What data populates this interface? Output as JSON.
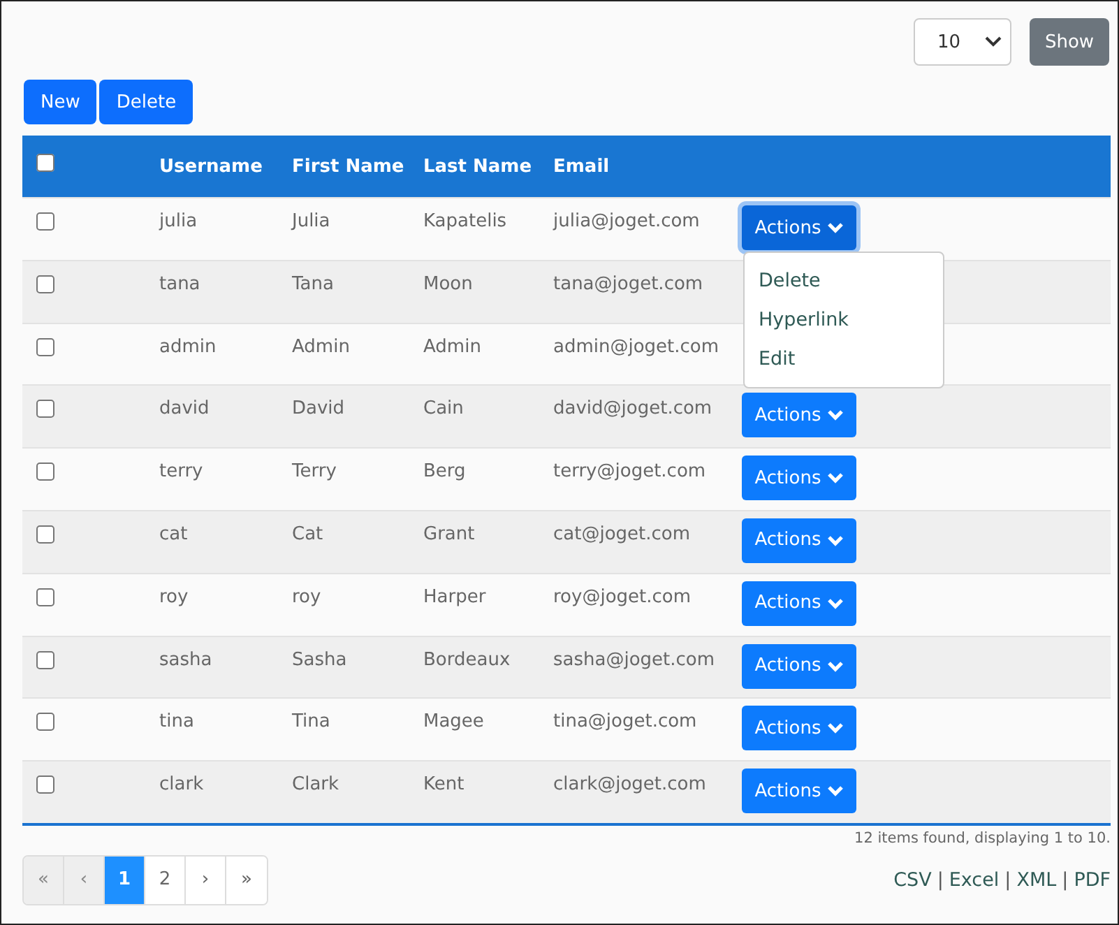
{
  "page_size": {
    "value": "10"
  },
  "show_button": "Show",
  "buttons": [
    "New",
    "Delete"
  ],
  "table": {
    "select_all": {
      "checked": false
    },
    "columns": [
      "Username",
      "First Name",
      "Last Name",
      "Email"
    ],
    "rows": [
      {
        "checked": false,
        "cells": [
          "julia",
          "Julia",
          "Kapatelis",
          "julia@joget.com"
        ],
        "actions": "Actions",
        "focused": true
      },
      {
        "checked": false,
        "cells": [
          "tana",
          "Tana",
          "Moon",
          "tana@joget.com"
        ]
      },
      {
        "checked": false,
        "cells": [
          "admin",
          "Admin",
          "Admin",
          "admin@joget.com"
        ]
      },
      {
        "checked": false,
        "cells": [
          "david",
          "David",
          "Cain",
          "david@joget.com"
        ],
        "actions": "Actions",
        "focused": false
      },
      {
        "checked": false,
        "cells": [
          "terry",
          "Terry",
          "Berg",
          "terry@joget.com"
        ],
        "actions": "Actions",
        "focused": false
      },
      {
        "checked": false,
        "cells": [
          "cat",
          "Cat",
          "Grant",
          "cat@joget.com"
        ],
        "actions": "Actions",
        "focused": false
      },
      {
        "checked": false,
        "cells": [
          "roy",
          "roy",
          "Harper",
          "roy@joget.com"
        ],
        "actions": "Actions",
        "focused": false
      },
      {
        "checked": false,
        "cells": [
          "sasha",
          "Sasha",
          "Bordeaux",
          "sasha@joget.com"
        ],
        "actions": "Actions",
        "focused": false
      },
      {
        "checked": false,
        "cells": [
          "tina",
          "Tina",
          "Magee",
          "tina@joget.com"
        ],
        "actions": "Actions",
        "focused": false
      },
      {
        "checked": false,
        "cells": [
          "clark",
          "Clark",
          "Kent",
          "clark@joget.com"
        ],
        "actions": "Actions",
        "focused": false
      }
    ]
  },
  "dropdown_menu": [
    "Delete",
    "Hyperlink",
    "Edit"
  ],
  "summary": "12 items found, displaying 1 to 10.",
  "pagination": [
    {
      "label": "«",
      "selected": false,
      "disabled": true
    },
    {
      "label": "‹",
      "selected": false,
      "disabled": true
    },
    {
      "label": "1",
      "selected": true,
      "disabled": false
    },
    {
      "label": "2",
      "selected": false,
      "disabled": false
    },
    {
      "label": "›",
      "selected": false,
      "disabled": false
    },
    {
      "label": "»",
      "selected": false,
      "disabled": false
    }
  ],
  "exports": [
    "CSV",
    "Excel",
    "XML",
    "PDF"
  ],
  "export_separator": "|"
}
